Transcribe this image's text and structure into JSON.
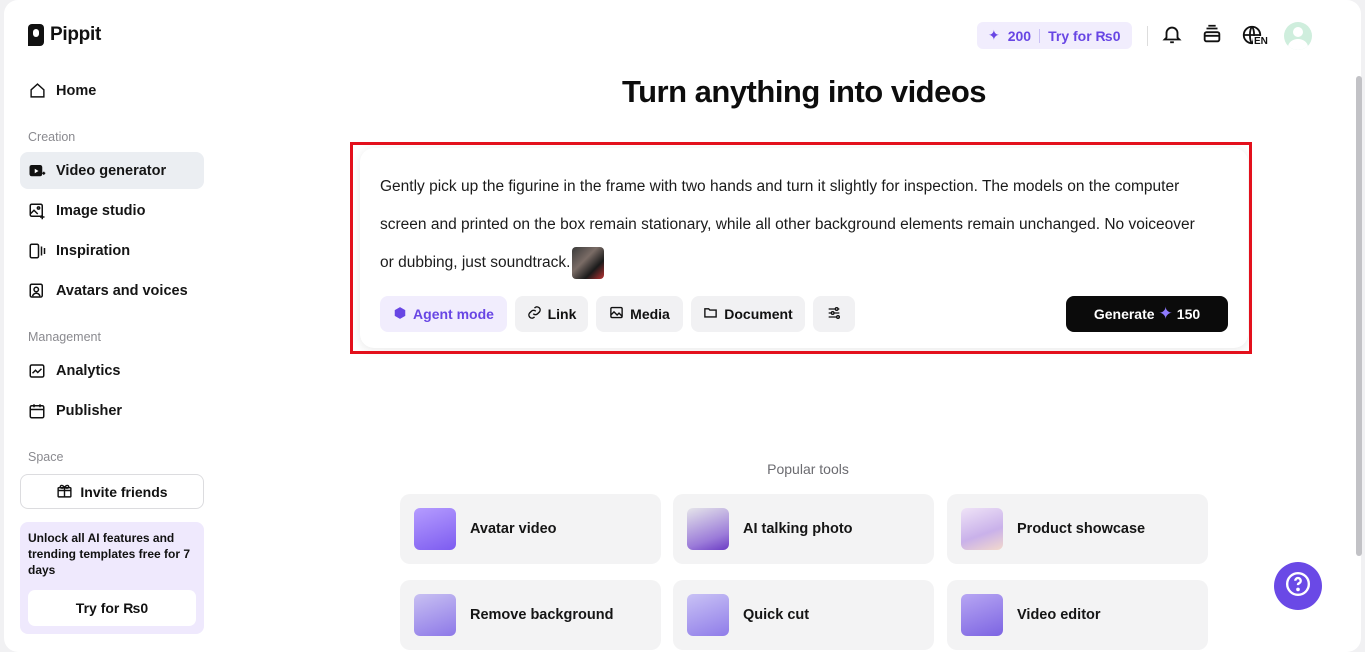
{
  "app": {
    "name": "Pippit"
  },
  "sidebar": {
    "home": "Home",
    "sections": {
      "creation": "Creation",
      "management": "Management",
      "space": "Space"
    },
    "creation_items": [
      "Video generator",
      "Image studio",
      "Inspiration",
      "Avatars and voices"
    ],
    "management_items": [
      "Analytics",
      "Publisher"
    ],
    "invite_label": "Invite friends",
    "promo": {
      "text": "Unlock all AI features and trending templates free for 7 days",
      "button": "Try for ₨0"
    }
  },
  "topbar": {
    "credits": "200",
    "try_label": "Try for ₨0",
    "language": "EN"
  },
  "main": {
    "title": "Turn anything into videos",
    "prompt_text": "Gently pick up the figurine in the frame with two hands and turn it slightly for inspection. The models on the computer screen and printed on the box remain stationary, while all other background elements remain unchanged. No voiceover or dubbing, just soundtrack.",
    "chips": {
      "agent": "Agent mode",
      "link": "Link",
      "media": "Media",
      "document": "Document"
    },
    "generate": {
      "label": "Generate",
      "cost": "150"
    },
    "popular_label": "Popular tools",
    "tools": [
      "Avatar video",
      "AI talking photo",
      "Product showcase",
      "Remove background",
      "Quick cut",
      "Video editor"
    ]
  },
  "colors": {
    "accent": "#6846e4",
    "highlight_border": "#e3101c",
    "active_nav": "#ebeef2"
  }
}
